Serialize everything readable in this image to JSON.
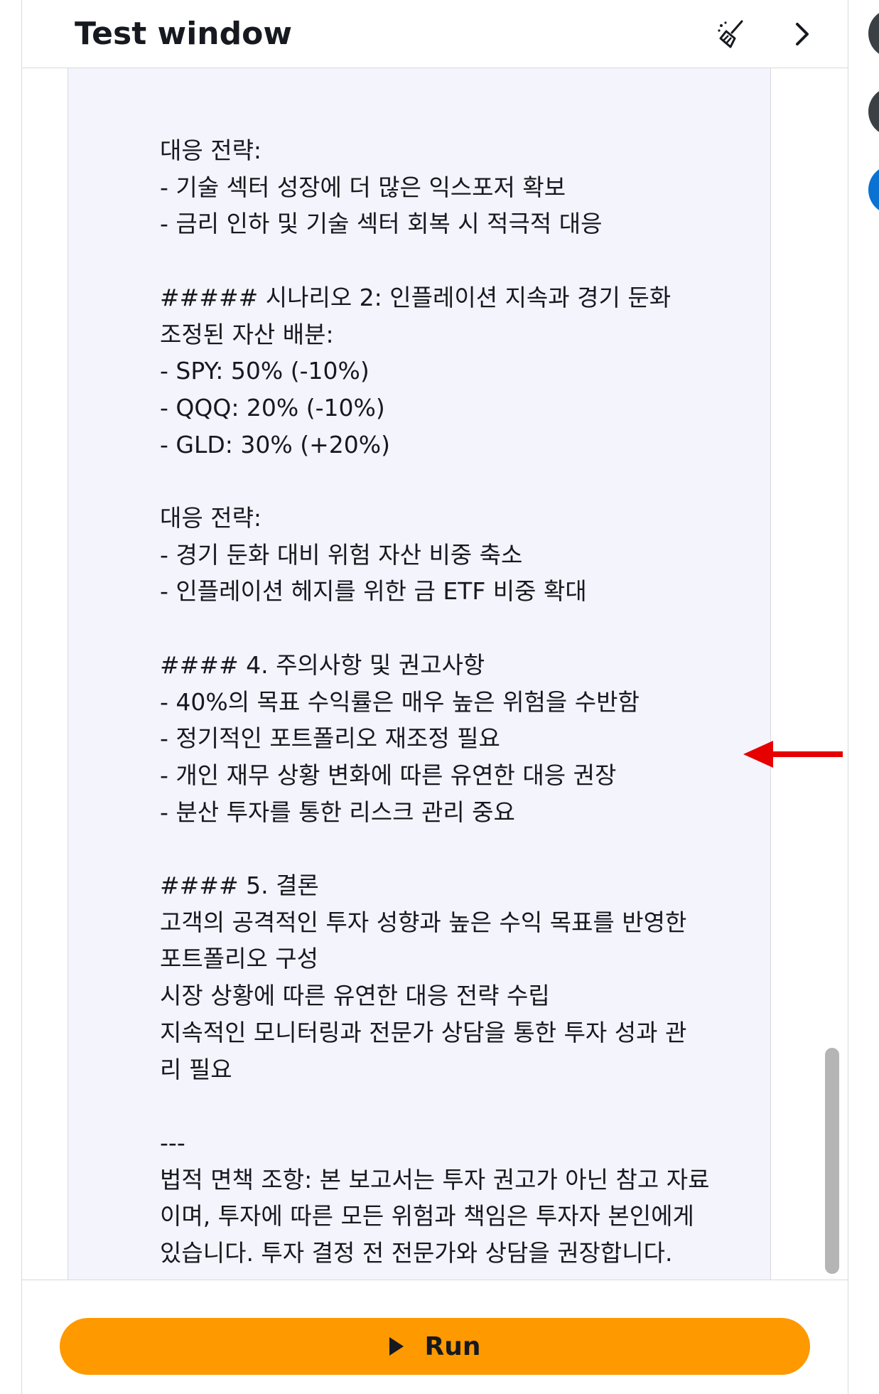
{
  "header": {
    "title": "Test window"
  },
  "icons": {
    "clear": "broom-icon",
    "collapse": "chevron-right-icon",
    "run": "play-icon"
  },
  "response": {
    "text": "대응 전략:\n- 기술 섹터 성장에 더 많은 익스포저 확보\n- 금리 인하 및 기술 섹터 회복 시 적극적 대응\n\n##### 시나리오 2: 인플레이션 지속과 경기 둔화\n조정된 자산 배분:\n- SPY: 50% (-10%)\n- QQQ: 20% (-10%)\n- GLD: 30% (+20%)\n\n대응 전략:\n- 경기 둔화 대비 위험 자산 비중 축소\n- 인플레이션 헤지를 위한 금 ETF 비중 확대\n\n#### 4. 주의사항 및 권고사항\n- 40%의 목표 수익률은 매우 높은 위험을 수반함\n- 정기적인 포트폴리오 재조정 필요\n- 개인 재무 상황 변화에 따른 유연한 대응 권장\n- 분산 투자를 통한 리스크 관리 중요\n\n#### 5. 결론\n고객의 공격적인 투자 성향과 높은 수익 목표를 반영한\n포트폴리오 구성\n시장 상황에 따른 유연한 대응 전략 수립\n지속적인 모니터링과 전문가 상담을 통한 투자 성과 관\n리 필요\n\n---\n법적 면책 조항: 본 보고서는 투자 권고가 아닌 참고 자료\n이며, 투자에 따른 모든 위험과 책임은 투자자 본인에게\n있습니다. 투자 결정 전 전문가와 상담을 권장합니다."
  },
  "actions": {
    "run_label": "Run"
  },
  "colors": {
    "run_button": "#ff9900",
    "response_bg": "#f4f4fc",
    "arrow": "#e60000",
    "side_circle_dark": "#3b4045",
    "side_circle_blue": "#0972d3"
  }
}
